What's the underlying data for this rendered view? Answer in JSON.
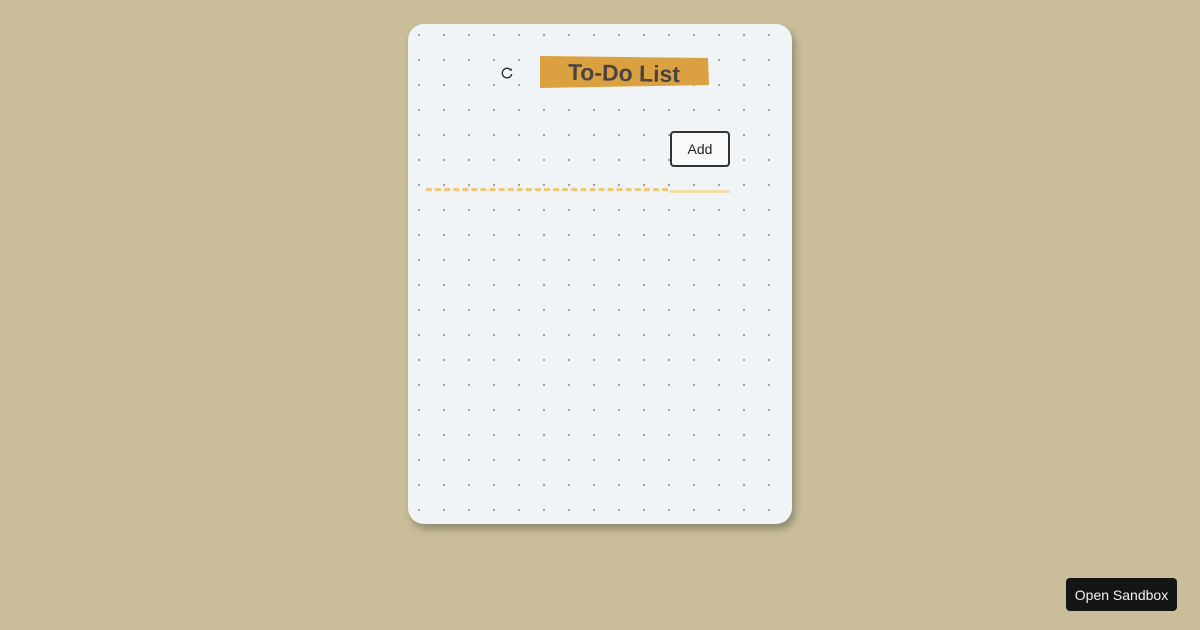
{
  "todo": {
    "title": "To-Do List",
    "refresh_icon": "refresh-icon",
    "input": {
      "value": "",
      "placeholder": ""
    },
    "add_label": "Add"
  },
  "sandbox": {
    "label": "Open Sandbox"
  },
  "colors": {
    "background": "#c9be99",
    "card": "#f0f4f7",
    "title_banner": "#dba040",
    "input_underline": "#f3c777",
    "sandbox_button": "#151515"
  }
}
